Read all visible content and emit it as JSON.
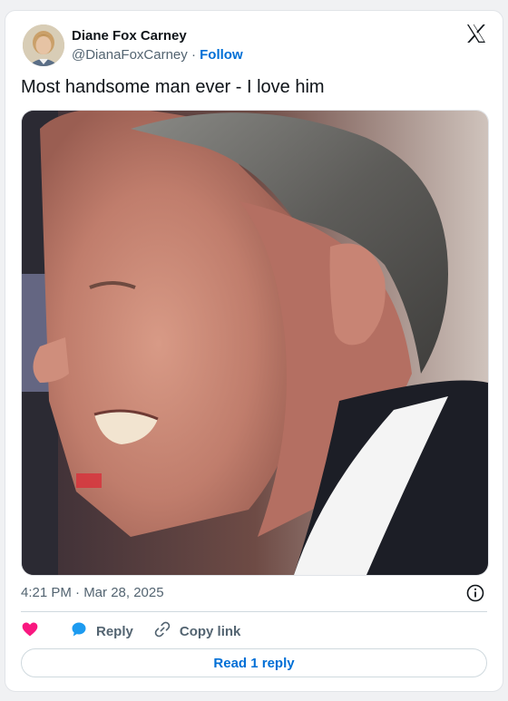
{
  "author": {
    "name": "Diane Fox Carney",
    "handle": "@DianaFoxCarney",
    "separator": "·",
    "follow_label": "Follow"
  },
  "tweet": {
    "text": "Most handsome man ever - I love him",
    "timestamp": "4:21 PM · Mar 28, 2025"
  },
  "actions": {
    "reply_label": "Reply",
    "copy_link_label": "Copy link",
    "read_replies_label": "Read 1 reply"
  },
  "icons": {
    "brand": "x-logo-icon",
    "info": "info-icon",
    "like": "heart-icon",
    "reply": "speech-bubble-icon",
    "copy": "link-icon"
  },
  "colors": {
    "link_blue": "#006fd6",
    "muted_text": "#536471",
    "like_pink": "#f91880",
    "reply_blue": "#1d9bf0"
  }
}
